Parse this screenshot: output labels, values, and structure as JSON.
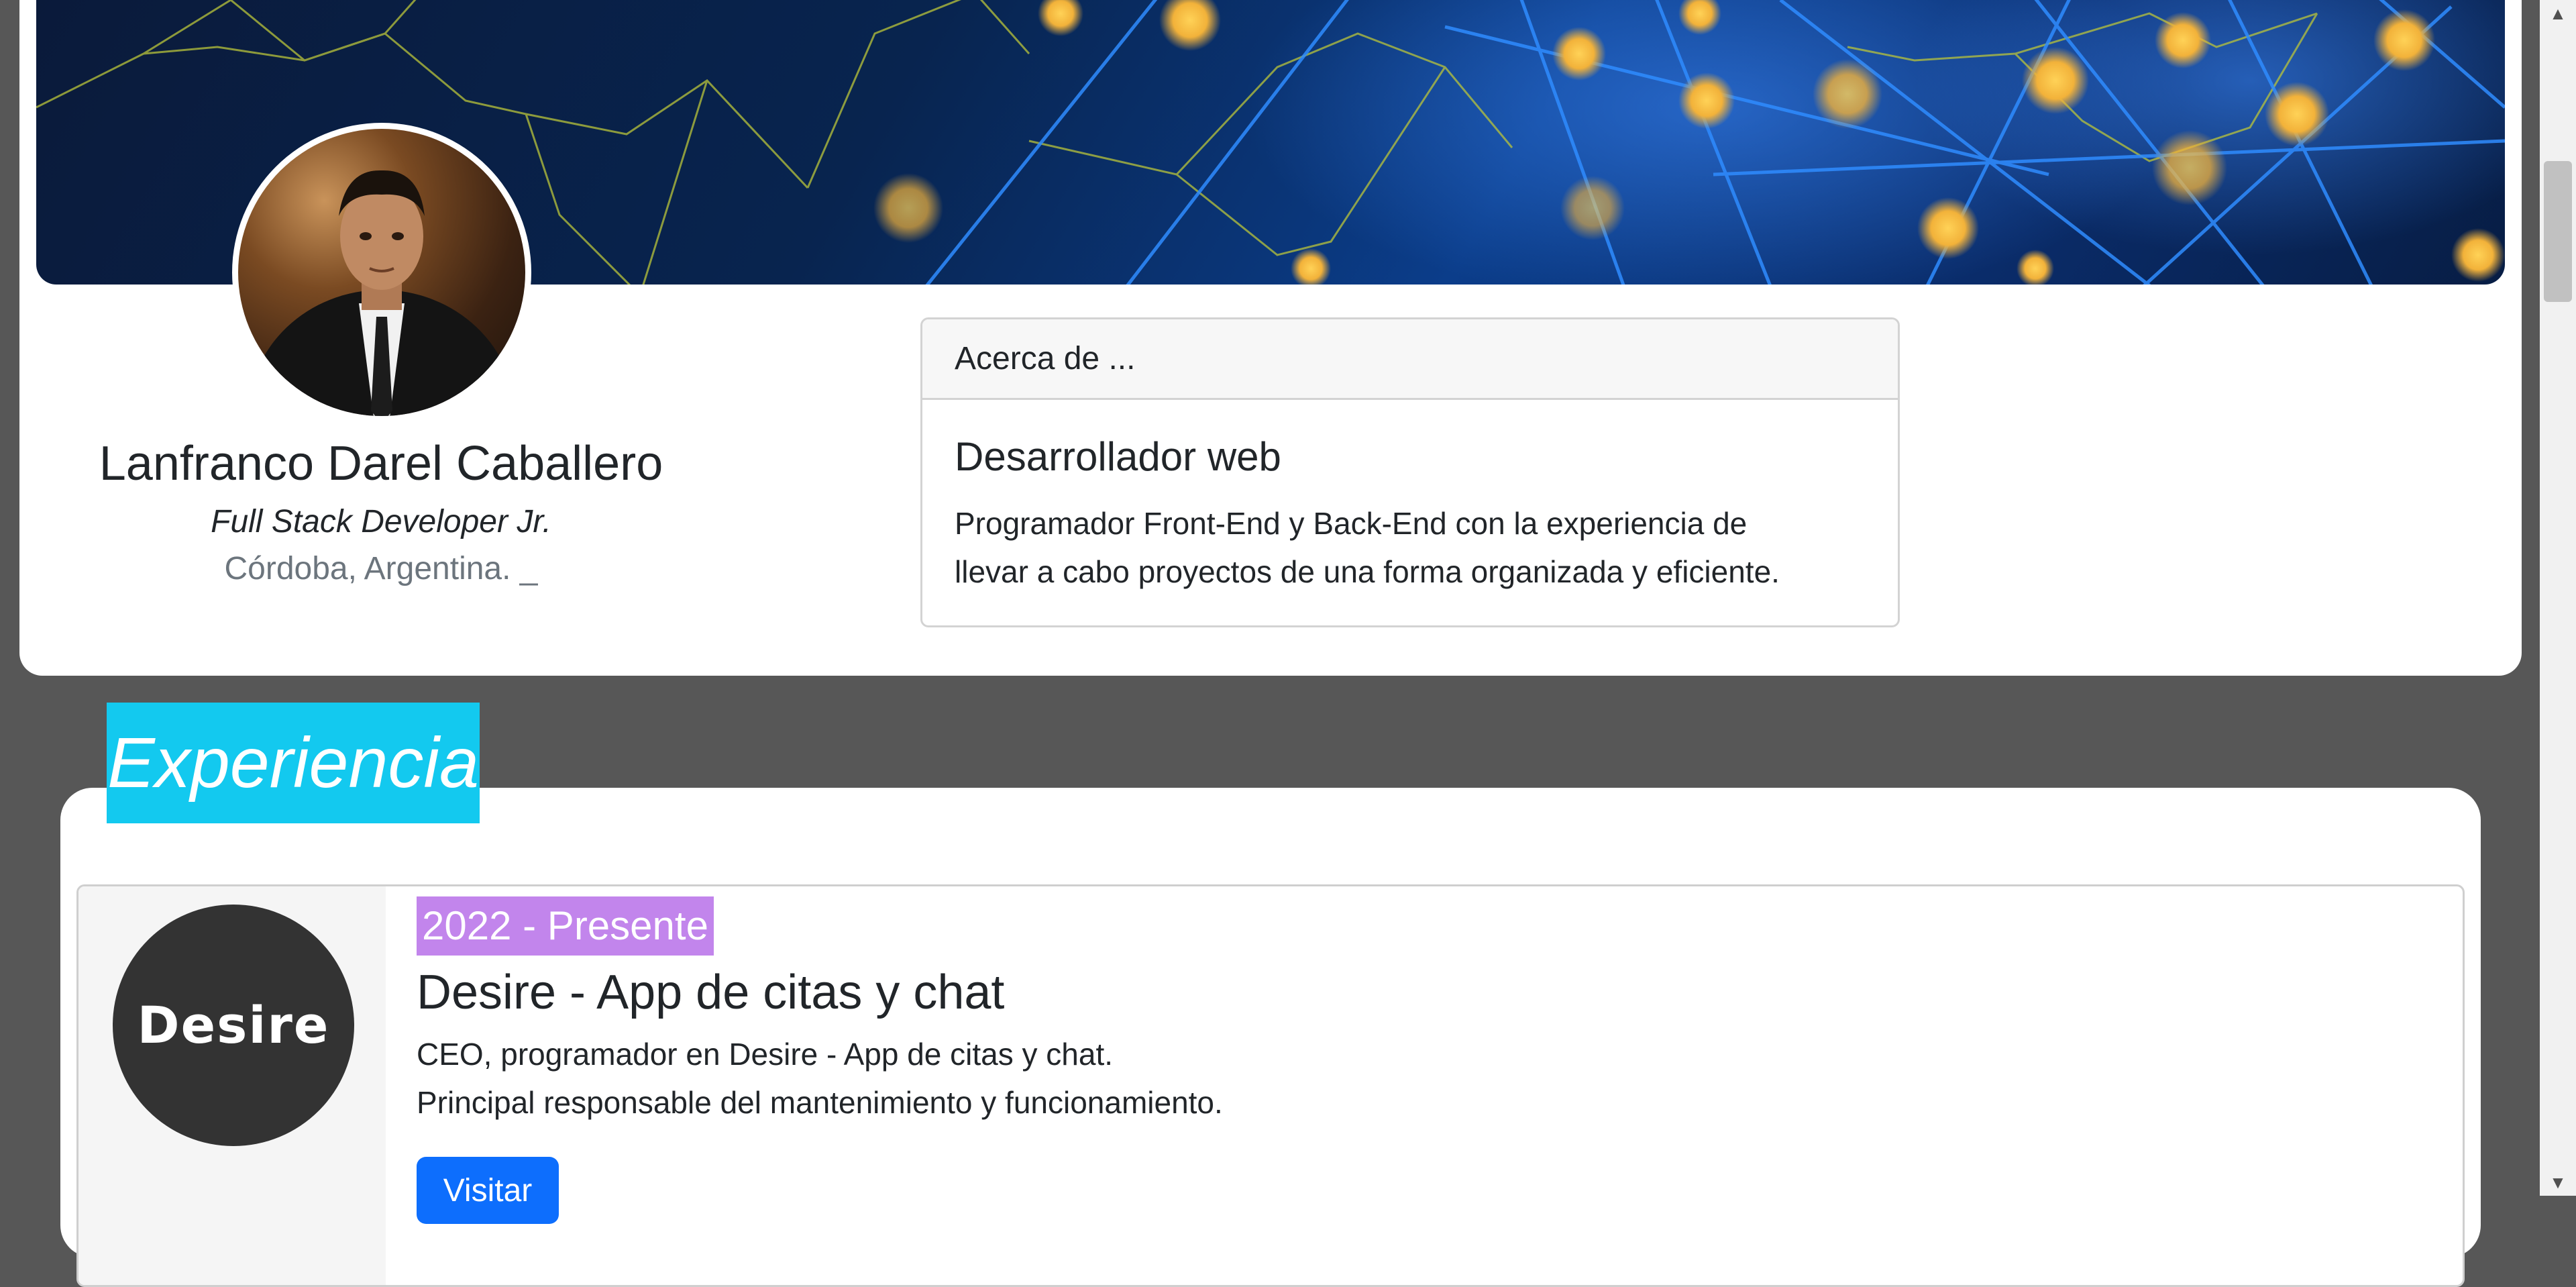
{
  "profile": {
    "name": "Lanfranco Darel Caballero",
    "role": "Full Stack Developer Jr.",
    "location": "Córdoba, Argentina. _"
  },
  "about": {
    "header": "Acerca de ...",
    "title": "Desarrollador web",
    "line1": "Programador Front-End y Back-End con la experiencia de",
    "line2": "llevar a cabo proyectos de una forma organizada y eficiente."
  },
  "experience": {
    "section_title": "Experiencia",
    "items": [
      {
        "logo_text": "Desire",
        "date": "2022 - Presente",
        "title": "Desire - App de citas y chat",
        "desc_line1": "CEO, programador en Desire - App de citas y chat.",
        "desc_line2": "Principal responsable del mantenimiento y funcionamiento.",
        "button_label": "Visitar"
      }
    ]
  },
  "colors": {
    "page_bg": "#575757",
    "section_tag": "#13c9ef",
    "date_badge": "#c285ec",
    "primary_button": "#0d6efd"
  }
}
